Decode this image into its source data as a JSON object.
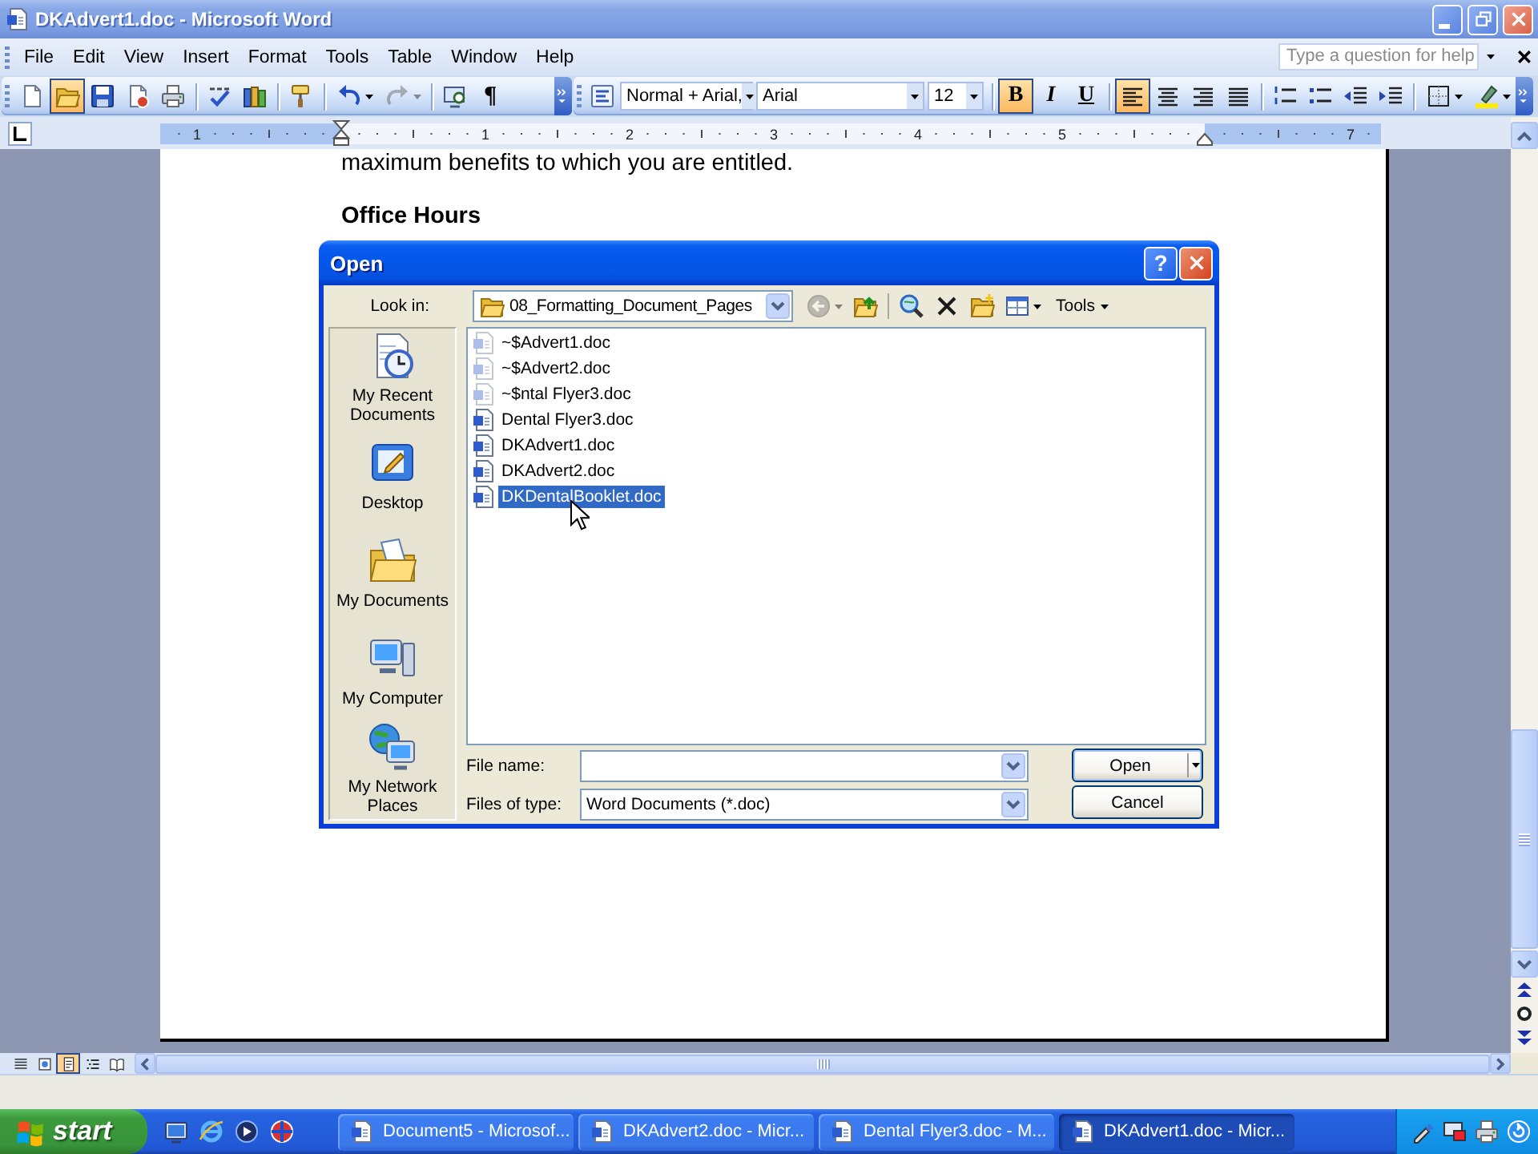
{
  "window": {
    "title": "DKAdvert1.doc - Microsoft Word"
  },
  "menu_bar": {
    "items": [
      "File",
      "Edit",
      "View",
      "Insert",
      "Format",
      "Tools",
      "Table",
      "Window",
      "Help"
    ],
    "help_box": {
      "placeholder": "Type a question for help"
    }
  },
  "standard_toolbar": {
    "groups": [
      [
        {
          "kind": "new",
          "highlighted": false,
          "disabled": false
        },
        {
          "kind": "open",
          "highlighted": true,
          "disabled": false
        },
        {
          "kind": "save",
          "highlighted": false,
          "disabled": false
        },
        {
          "kind": "permission",
          "highlighted": false,
          "disabled": false
        },
        {
          "kind": "print",
          "highlighted": false,
          "disabled": false
        }
      ],
      [
        {
          "kind": "spelling",
          "highlighted": false,
          "disabled": false
        },
        {
          "kind": "research",
          "highlighted": false,
          "disabled": false
        }
      ],
      [
        {
          "kind": "format-painter",
          "highlighted": false,
          "disabled": false
        }
      ],
      [
        {
          "kind": "undo",
          "highlighted": false,
          "disabled": false
        },
        {
          "kind": "redo",
          "highlighted": false,
          "disabled": true
        }
      ],
      [
        {
          "kind": "reading",
          "highlighted": false,
          "disabled": false
        },
        {
          "kind": "show-hide",
          "label": "¶",
          "highlighted": false,
          "disabled": false
        }
      ]
    ]
  },
  "formatting_toolbar": {
    "style": "Normal + Arial,",
    "font": "Arial",
    "size": "12",
    "groups": [
      [
        {
          "kind": "bold",
          "label": "B",
          "on": true
        },
        {
          "kind": "italic",
          "label": "I",
          "on": false
        },
        {
          "kind": "underline",
          "label": "U",
          "on": false
        }
      ],
      [
        {
          "kind": "align-left",
          "on": true
        },
        {
          "kind": "align-center",
          "on": false
        },
        {
          "kind": "align-right",
          "on": false
        },
        {
          "kind": "justify",
          "on": false
        }
      ],
      [
        {
          "kind": "numbering",
          "on": false
        },
        {
          "kind": "bullets",
          "on": false
        },
        {
          "kind": "outdent",
          "on": false
        },
        {
          "kind": "indent",
          "on": false
        }
      ],
      [
        {
          "kind": "border",
          "on": false
        },
        {
          "kind": "highlight",
          "on": false
        }
      ]
    ]
  },
  "ruler": {
    "labels": [
      "1",
      "1",
      "2",
      "3",
      "4",
      "5",
      "7"
    ]
  },
  "document": {
    "paragraphs": [
      {
        "kind": "body",
        "text": "maximum benefits to which you are entitled."
      },
      {
        "kind": "heading",
        "text": "Office Hours"
      }
    ]
  },
  "view_buttons": [
    {
      "kind": "normal",
      "selected": false
    },
    {
      "kind": "web",
      "selected": false
    },
    {
      "kind": "print-layout",
      "selected": true
    },
    {
      "kind": "outline",
      "selected": false
    },
    {
      "kind": "reading",
      "selected": false
    }
  ],
  "open_dialog": {
    "title": "Open",
    "help_button": "?",
    "look_in": {
      "label": "Look in:",
      "value": "08_Formatting_Document_Pages"
    },
    "toolbar": [
      {
        "kind": "back",
        "disabled": true
      },
      {
        "kind": "up-folder",
        "disabled": false
      },
      {
        "kind": "search-web",
        "disabled": false
      },
      {
        "kind": "delete",
        "disabled": false
      },
      {
        "kind": "new-folder",
        "disabled": false
      },
      {
        "kind": "views",
        "disabled": false
      }
    ],
    "tools_menu": "Tools",
    "places": [
      {
        "kind": "recent",
        "label": "My Recent Documents"
      },
      {
        "kind": "desktop",
        "label": "Desktop"
      },
      {
        "kind": "documents",
        "label": "My Documents"
      },
      {
        "kind": "computer",
        "label": "My Computer"
      },
      {
        "kind": "network",
        "label": "My Network Places"
      }
    ],
    "files": [
      {
        "name": "~$Advert1.doc",
        "hidden": true,
        "selected": false
      },
      {
        "name": "~$Advert2.doc",
        "hidden": true,
        "selected": false
      },
      {
        "name": "~$ntal Flyer3.doc",
        "hidden": true,
        "selected": false
      },
      {
        "name": "Dental Flyer3.doc",
        "hidden": false,
        "selected": false
      },
      {
        "name": "DKAdvert1.doc",
        "hidden": false,
        "selected": false
      },
      {
        "name": "DKAdvert2.doc",
        "hidden": false,
        "selected": false
      },
      {
        "name": "DKDentalBooklet.doc",
        "hidden": false,
        "selected": true
      }
    ],
    "file_name": {
      "label": "File name:"
    },
    "file_type": {
      "label": "Files of type:",
      "value": "Word Documents (*.doc)"
    },
    "buttons": [
      {
        "kind": "open",
        "label": "Open"
      },
      {
        "kind": "cancel",
        "label": "Cancel"
      }
    ]
  },
  "taskbar": {
    "start": "start",
    "quick_launch": [
      {
        "kind": "desktop"
      },
      {
        "kind": "browser"
      },
      {
        "kind": "media"
      },
      {
        "kind": "globe"
      }
    ],
    "tasks": [
      {
        "label": "Document5 - Microsof...",
        "selected": false
      },
      {
        "label": "DKAdvert2.doc - Micr...",
        "selected": false
      },
      {
        "label": "Dental Flyer3.doc - M...",
        "selected": false
      },
      {
        "label": "DKAdvert1.doc - Micr...",
        "selected": true
      }
    ],
    "tray": [
      {
        "kind": "tool"
      },
      {
        "kind": "monitor"
      },
      {
        "kind": "printer"
      },
      {
        "kind": "update"
      }
    ]
  }
}
